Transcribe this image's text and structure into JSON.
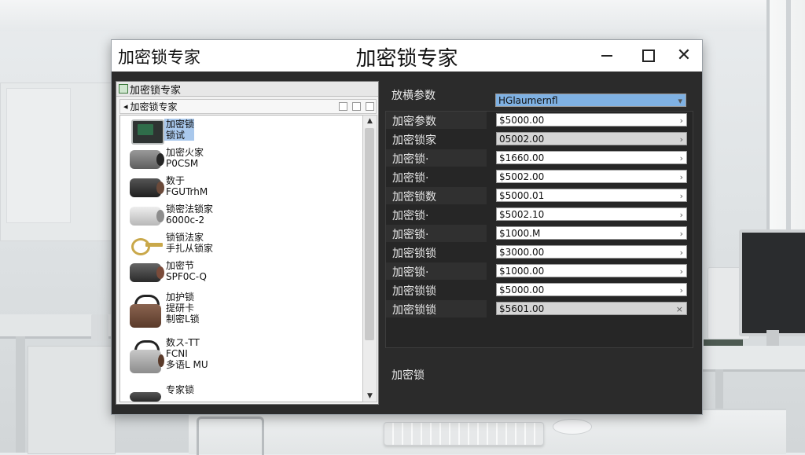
{
  "window": {
    "title_left": "加密锁专家",
    "title_center": "加密锁专家"
  },
  "explorer": {
    "header": "加密锁专家",
    "sub_header": "加密锁专家",
    "items": [
      {
        "line1": "加密锁",
        "line2": "锁试",
        "icon": "lock-device-icon"
      },
      {
        "line1": "加密火家",
        "line2": "P0CSM",
        "icon": "lock-device-icon"
      },
      {
        "line1": "数于",
        "line2": "FGUTrhM",
        "icon": "lock-device-icon"
      },
      {
        "line1": "锁密法锁家",
        "line2": "6000c-2",
        "icon": "lock-device-icon"
      },
      {
        "line1": "锁锁法家",
        "line2": "手扎从锁家",
        "icon": "key-icon"
      },
      {
        "line1": "加密节",
        "line2": "SPF0C-Q",
        "icon": "lock-device-icon"
      },
      {
        "line1": "加护锁",
        "line2": "提研卡",
        "line3": "制密L锁",
        "icon": "lock-device-icon"
      },
      {
        "line1": "数ス-TT",
        "line2": "FCNI",
        "line3": "多语L MU",
        "icon": "lock-device-icon"
      },
      {
        "line1": "专家锁",
        "line2": "",
        "icon": "lock-device-icon"
      }
    ]
  },
  "params": {
    "header_label": "放横参数",
    "header_value": "HGlaumernfl",
    "rows": [
      {
        "label": "加密参数",
        "value": "$5000.00",
        "style": "white",
        "arrow": "›"
      },
      {
        "label": "加密锁家",
        "value": "05002.00",
        "style": "grey",
        "arrow": "›"
      },
      {
        "label": "加密锁·",
        "value": "$1660.00",
        "style": "white",
        "arrow": "›"
      },
      {
        "label": "加密锁·",
        "value": "$5002.00",
        "style": "white",
        "arrow": "›"
      },
      {
        "label": "加密锁数",
        "value": "$5000.01",
        "style": "white",
        "arrow": "›"
      },
      {
        "label": "加密锁·",
        "value": "$5002.10",
        "style": "white",
        "arrow": "›"
      },
      {
        "label": "加密锁·",
        "value": "$1000.M",
        "style": "white",
        "arrow": "›"
      },
      {
        "label": "加密锁锁",
        "value": "$3000.00",
        "style": "white",
        "arrow": "›"
      },
      {
        "label": "加密锁·",
        "value": "$1000.00",
        "style": "white",
        "arrow": "›"
      },
      {
        "label": "加密锁锁",
        "value": "$5000.00",
        "style": "white",
        "arrow": "›"
      },
      {
        "label": "加密锁锁",
        "value": "$5601.00",
        "style": "grey",
        "arrow": "×"
      }
    ],
    "extra_label": "加密锁"
  }
}
